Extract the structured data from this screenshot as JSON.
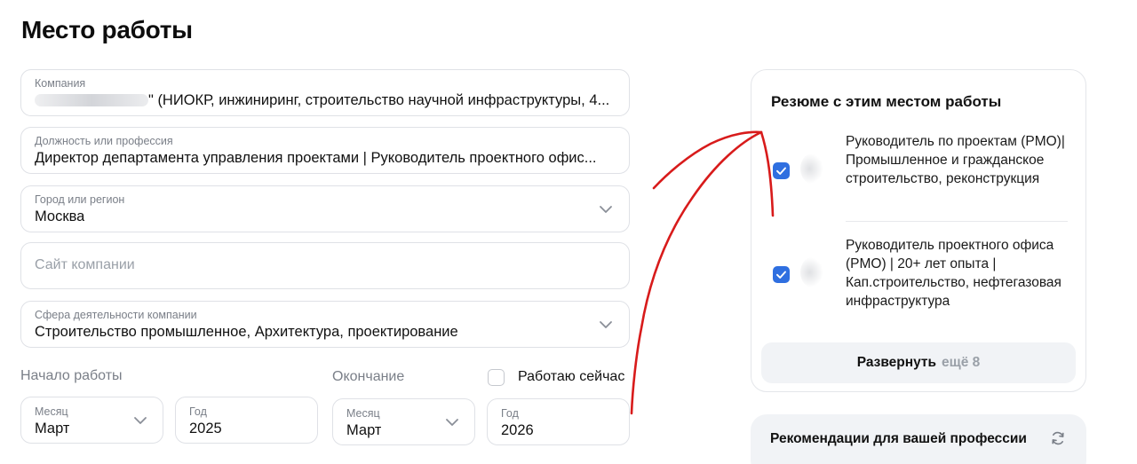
{
  "page": {
    "title": "Место работы"
  },
  "form": {
    "company": {
      "label": "Компания",
      "value_visible": "\" (НИОКР, инжиниринг, строительство научной инфраструктуры, 4..."
    },
    "position": {
      "label": "Должность или профессия",
      "value": "Директор департамента управления проектами | Руководитель проектного офис..."
    },
    "city": {
      "label": "Город или регион",
      "value": "Москва"
    },
    "website": {
      "placeholder": "Сайт компании"
    },
    "industry": {
      "label": "Сфера деятельности компании",
      "value": "Строительство промышленное, Архитектура, проектирование"
    },
    "start": {
      "section_label": "Начало работы",
      "month": {
        "label": "Месяц",
        "value": "Март"
      },
      "year": {
        "label": "Год",
        "value": "2025"
      }
    },
    "end": {
      "section_label": "Окончание",
      "month": {
        "label": "Месяц",
        "value": "Март"
      },
      "year": {
        "label": "Год",
        "value": "2026"
      }
    },
    "currently_working": {
      "label": "Работаю сейчас",
      "checked": false
    }
  },
  "resume_card": {
    "title": "Резюме с этим местом работы",
    "items": [
      {
        "title": "Руководитель по проектам (PMO)| Промышленное и гражданское строительство, реконструкция",
        "checked": true
      },
      {
        "title": "Руководитель проектного офиса (PMO) | 20+ лет опыта | Кап.строительство, нефтегазовая инфраструктура",
        "checked": true
      }
    ],
    "expand_label": "Развернуть",
    "expand_more": "ещё 8"
  },
  "recommendations": {
    "title": "Рекомендации для вашей профессии"
  },
  "icons": {
    "dropdown": "chevron-down-icon",
    "checkbox_checked": "check-icon",
    "refresh": "refresh-icon"
  },
  "colors": {
    "accent": "#2f6fe0",
    "annotation_stroke": "#d81b1b",
    "muted_text": "#7a7f88",
    "border": "#dfe1e6"
  }
}
